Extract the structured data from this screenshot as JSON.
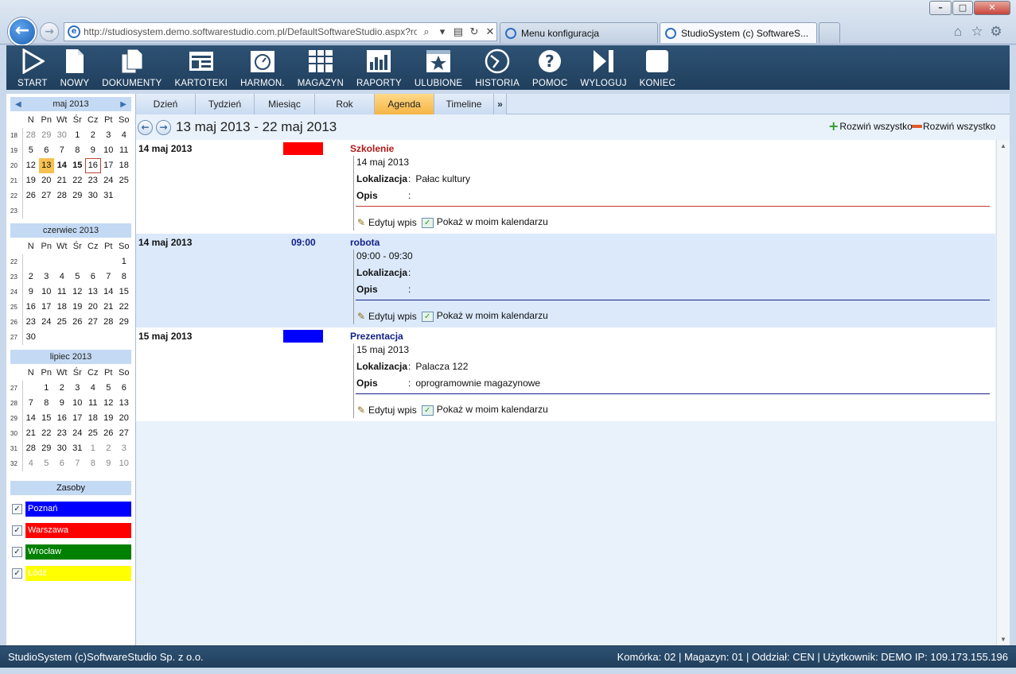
{
  "browser": {
    "url": "http://studiosystem.demo.softwarestudio.com.pl/DefaultSoftwareStudio.aspx?rola",
    "tabs": [
      {
        "title": "Menu konfiguracja"
      },
      {
        "title": "StudioSystem (c) SoftwareS..."
      }
    ],
    "window_buttons": [
      "–",
      "□",
      "✕"
    ]
  },
  "toolbar": {
    "items": [
      "START",
      "NOWY",
      "DOKUMENTY",
      "KARTOTEKI",
      "HARMON.",
      "MAGAZYN",
      "RAPORTY",
      "ULUBIONE",
      "HISTORIA",
      "POMOC",
      "WYLOGUJ",
      "KONIEC"
    ]
  },
  "calendars": [
    {
      "title": "maj 2013",
      "arrows": true,
      "weekdays": [
        "N",
        "Pn",
        "Wt",
        "Śr",
        "Cz",
        "Pt",
        "So"
      ],
      "weeks": [
        {
          "wk": "18",
          "days": [
            {
              "d": "28",
              "om": true
            },
            {
              "d": "29",
              "om": true
            },
            {
              "d": "30",
              "om": true
            },
            {
              "d": "1"
            },
            {
              "d": "2"
            },
            {
              "d": "3"
            },
            {
              "d": "4"
            }
          ]
        },
        {
          "wk": "19",
          "days": [
            {
              "d": "5"
            },
            {
              "d": "6"
            },
            {
              "d": "7"
            },
            {
              "d": "8"
            },
            {
              "d": "9"
            },
            {
              "d": "10"
            },
            {
              "d": "11"
            }
          ]
        },
        {
          "wk": "20",
          "days": [
            {
              "d": "12"
            },
            {
              "d": "13",
              "sel": true
            },
            {
              "d": "14",
              "bold": true
            },
            {
              "d": "15",
              "bold": true
            },
            {
              "d": "16",
              "today": true
            },
            {
              "d": "17"
            },
            {
              "d": "18"
            }
          ]
        },
        {
          "wk": "21",
          "days": [
            {
              "d": "19"
            },
            {
              "d": "20"
            },
            {
              "d": "21"
            },
            {
              "d": "22"
            },
            {
              "d": "23"
            },
            {
              "d": "24"
            },
            {
              "d": "25"
            }
          ]
        },
        {
          "wk": "22",
          "days": [
            {
              "d": "26"
            },
            {
              "d": "27"
            },
            {
              "d": "28"
            },
            {
              "d": "29"
            },
            {
              "d": "30"
            },
            {
              "d": "31"
            },
            {
              "d": ""
            }
          ]
        },
        {
          "wk": "23",
          "days": [
            {
              "d": ""
            },
            {
              "d": ""
            },
            {
              "d": ""
            },
            {
              "d": ""
            },
            {
              "d": ""
            },
            {
              "d": ""
            },
            {
              "d": ""
            }
          ]
        }
      ]
    },
    {
      "title": "czerwiec 2013",
      "arrows": false,
      "weekdays": [
        "N",
        "Pn",
        "Wt",
        "Śr",
        "Cz",
        "Pt",
        "So"
      ],
      "weeks": [
        {
          "wk": "22",
          "days": [
            {
              "d": ""
            },
            {
              "d": ""
            },
            {
              "d": ""
            },
            {
              "d": ""
            },
            {
              "d": ""
            },
            {
              "d": ""
            },
            {
              "d": "1"
            }
          ]
        },
        {
          "wk": "23",
          "days": [
            {
              "d": "2"
            },
            {
              "d": "3"
            },
            {
              "d": "4"
            },
            {
              "d": "5"
            },
            {
              "d": "6"
            },
            {
              "d": "7"
            },
            {
              "d": "8"
            }
          ]
        },
        {
          "wk": "24",
          "days": [
            {
              "d": "9"
            },
            {
              "d": "10"
            },
            {
              "d": "11"
            },
            {
              "d": "12"
            },
            {
              "d": "13"
            },
            {
              "d": "14"
            },
            {
              "d": "15"
            }
          ]
        },
        {
          "wk": "25",
          "days": [
            {
              "d": "16"
            },
            {
              "d": "17"
            },
            {
              "d": "18"
            },
            {
              "d": "19"
            },
            {
              "d": "20"
            },
            {
              "d": "21"
            },
            {
              "d": "22"
            }
          ]
        },
        {
          "wk": "26",
          "days": [
            {
              "d": "23"
            },
            {
              "d": "24"
            },
            {
              "d": "25"
            },
            {
              "d": "26"
            },
            {
              "d": "27"
            },
            {
              "d": "28"
            },
            {
              "d": "29"
            }
          ]
        },
        {
          "wk": "27",
          "days": [
            {
              "d": "30"
            },
            {
              "d": ""
            },
            {
              "d": ""
            },
            {
              "d": ""
            },
            {
              "d": ""
            },
            {
              "d": ""
            },
            {
              "d": ""
            }
          ]
        }
      ]
    },
    {
      "title": "lipiec 2013",
      "arrows": false,
      "weekdays": [
        "N",
        "Pn",
        "Wt",
        "Śr",
        "Cz",
        "Pt",
        "So"
      ],
      "weeks": [
        {
          "wk": "27",
          "days": [
            {
              "d": ""
            },
            {
              "d": "1"
            },
            {
              "d": "2"
            },
            {
              "d": "3"
            },
            {
              "d": "4"
            },
            {
              "d": "5"
            },
            {
              "d": "6"
            }
          ]
        },
        {
          "wk": "28",
          "days": [
            {
              "d": "7"
            },
            {
              "d": "8"
            },
            {
              "d": "9"
            },
            {
              "d": "10"
            },
            {
              "d": "11"
            },
            {
              "d": "12"
            },
            {
              "d": "13"
            }
          ]
        },
        {
          "wk": "29",
          "days": [
            {
              "d": "14"
            },
            {
              "d": "15"
            },
            {
              "d": "16"
            },
            {
              "d": "17"
            },
            {
              "d": "18"
            },
            {
              "d": "19"
            },
            {
              "d": "20"
            }
          ]
        },
        {
          "wk": "30",
          "days": [
            {
              "d": "21"
            },
            {
              "d": "22"
            },
            {
              "d": "23"
            },
            {
              "d": "24"
            },
            {
              "d": "25"
            },
            {
              "d": "26"
            },
            {
              "d": "27"
            }
          ]
        },
        {
          "wk": "31",
          "days": [
            {
              "d": "28"
            },
            {
              "d": "29"
            },
            {
              "d": "30"
            },
            {
              "d": "31"
            },
            {
              "d": "1",
              "om": true
            },
            {
              "d": "2",
              "om": true
            },
            {
              "d": "3",
              "om": true
            }
          ]
        },
        {
          "wk": "32",
          "days": [
            {
              "d": "4",
              "om": true
            },
            {
              "d": "5",
              "om": true
            },
            {
              "d": "6",
              "om": true
            },
            {
              "d": "7",
              "om": true
            },
            {
              "d": "8",
              "om": true
            },
            {
              "d": "9",
              "om": true
            },
            {
              "d": "10",
              "om": true
            }
          ]
        }
      ]
    }
  ],
  "resources": {
    "title": "Zasoby",
    "items": [
      {
        "label": "Poznań",
        "color": "#0000ff",
        "text_color": "#ffffff"
      },
      {
        "label": "Warszawa",
        "color": "#ff0000",
        "text_color": "#ffffff"
      },
      {
        "label": "Wrocław",
        "color": "#008000",
        "text_color": "#ffffff"
      },
      {
        "label": "Łódź",
        "color": "#ffff00",
        "text_color": "#ffffff"
      }
    ]
  },
  "view_tabs": {
    "items": [
      "Dzień",
      "Tydzień",
      "Miesiąc",
      "Rok",
      "Agenda",
      "Timeline"
    ],
    "active": "Agenda",
    "more": "»"
  },
  "agenda": {
    "range": "13 maj 2013 - 22 maj 2013",
    "expand_all": "Rozwiń wszystko",
    "collapse_all": "Rozwiń wszystko",
    "labels": {
      "location": "Lokalizacja",
      "description": "Opis",
      "edit": "Edytuj wpis",
      "show": "Pokaż w moim kalendarzu"
    },
    "entries": [
      {
        "date": "14 maj 2013",
        "swatch": "#ff0000",
        "time": "",
        "title": "Szkolenie",
        "title_color": "#b01a1a",
        "sub": "14 maj 2013",
        "location": "Pałac kultury",
        "description": "",
        "line_color": "#c23a3a"
      },
      {
        "date": "14 maj 2013",
        "swatch": "",
        "time": "09:00",
        "title": "robota",
        "title_color": "#13218a",
        "sub": "09:00 - 09:30",
        "location": "",
        "description": "",
        "line_color": "#13218a"
      },
      {
        "date": "15 maj 2013",
        "swatch": "#0000ff",
        "time": "",
        "title": "Prezentacja",
        "title_color": "#13218a",
        "sub": "15 maj 2013",
        "location": "Palacza 122",
        "description": "oprogramownie magazynowe",
        "line_color": "#13218a"
      }
    ]
  },
  "status": {
    "left": "StudioSystem (c)SoftwareStudio Sp. z o.o.",
    "right": "Komórka: 02 | Magazyn: 01 | Oddział: CEN | Użytkownik: DEMO IP: 109.173.155.196"
  }
}
